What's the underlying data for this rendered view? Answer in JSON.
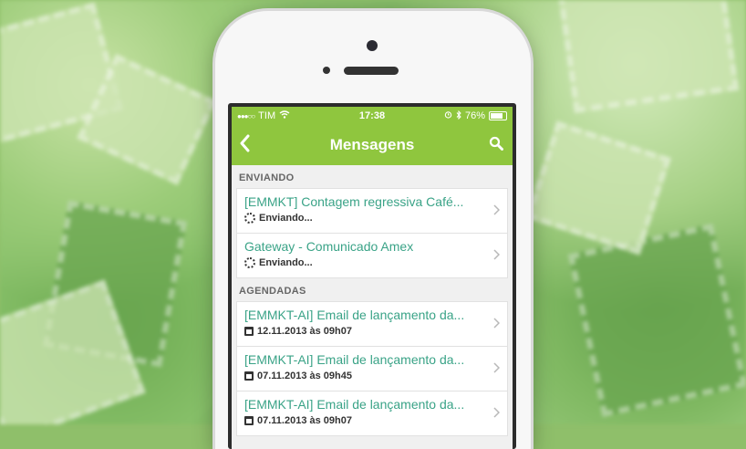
{
  "status_bar": {
    "carrier": "TIM",
    "time": "17:38",
    "battery": "76%"
  },
  "nav": {
    "title": "Mensagens"
  },
  "sections": [
    {
      "title": "ENVIANDO",
      "items": [
        {
          "subject": "[EMMKT] Contagem regressiva Café...",
          "meta": "Enviando...",
          "icon": "spinner-icon"
        },
        {
          "subject": "Gateway - Comunicado Amex",
          "meta": "Enviando...",
          "icon": "spinner-icon"
        }
      ]
    },
    {
      "title": "AGENDADAS",
      "items": [
        {
          "subject": "[EMMKT-AI] Email de lançamento da...",
          "meta": "12.11.2013 às 09h07",
          "icon": "calendar-icon"
        },
        {
          "subject": "[EMMKT-AI] Email de lançamento da...",
          "meta": "07.11.2013 às 09h45",
          "icon": "calendar-icon"
        },
        {
          "subject": "[EMMKT-AI] Email de lançamento da...",
          "meta": "07.11.2013 às 09h07",
          "icon": "calendar-icon"
        }
      ]
    }
  ],
  "colors": {
    "accent": "#8fc63e",
    "link_text": "#3aa387"
  }
}
